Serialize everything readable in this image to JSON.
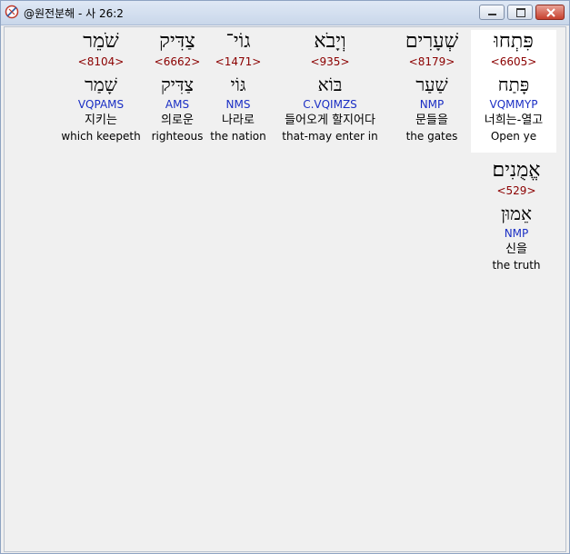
{
  "window": {
    "title": "@원전분해 - 사 26:2"
  },
  "words": [
    {
      "hebrew": "פִּתְחוּ",
      "strong": "<6605>",
      "lemma": "פָּתַח",
      "morph": "VQMMYP",
      "korean": "너희는-열고",
      "english": "Open ye",
      "selected": true
    },
    {
      "hebrew": "שְׁעָרִים",
      "strong": "<8179>",
      "lemma": "שַׁעַר",
      "morph": "NMP",
      "korean": "문들을",
      "english": "the gates",
      "selected": false
    },
    {
      "hebrew": "וְיָבֹא",
      "strong": "<935>",
      "lemma": "בּוֹא",
      "morph": "C.VQIMZS",
      "korean": "들어오게 할지어다",
      "english": "that-may enter in",
      "selected": false
    },
    {
      "hebrew": "גוֹי־",
      "strong": "<1471>",
      "lemma": "גּוֹי",
      "morph": "NMS",
      "korean": "나라로",
      "english": "the nation",
      "selected": false
    },
    {
      "hebrew": "צַדִּיק",
      "strong": "<6662>",
      "lemma": "צַדִּיק",
      "morph": "AMS",
      "korean": "의로운",
      "english": "righteous",
      "selected": false
    },
    {
      "hebrew": "שֹׁמֵר",
      "strong": "<8104>",
      "lemma": "שָׁמַר",
      "morph": "VQPAMS",
      "korean": "지키는",
      "english": "which keepeth",
      "selected": false
    },
    {
      "hebrew": "אֱמֻנִים׃",
      "strong": "<529>",
      "lemma": "אֵמוּן",
      "morph": "NMP",
      "korean": "신을",
      "english": "the truth",
      "selected": false
    }
  ]
}
